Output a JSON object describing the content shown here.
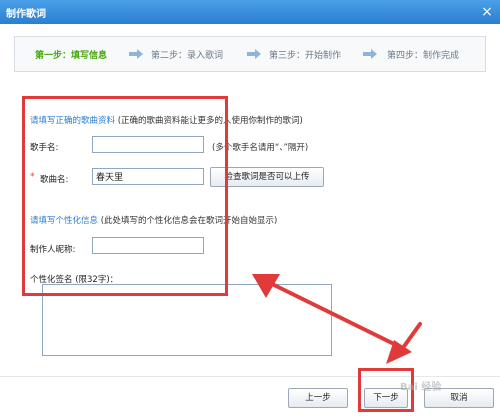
{
  "window": {
    "title": "制作歌词",
    "close_label": "×"
  },
  "steps": [
    {
      "label": "第一步：填写信息"
    },
    {
      "label": "第二步：录入歌词"
    },
    {
      "label": "第三步：开始制作"
    },
    {
      "label": "第四步：制作完成"
    }
  ],
  "section1": {
    "title": "请填写正确的歌曲资料",
    "note": "(正确的歌曲资料能让更多的人使用你制作的歌词)"
  },
  "singer": {
    "label": "歌手名:",
    "value": "",
    "hint": "(多个歌手名请用“、”隔开)"
  },
  "song": {
    "star": "*",
    "label": "歌曲名:",
    "value": "春天里",
    "check_button": "检查歌词是否可以上传"
  },
  "section2": {
    "title": "请填写个性化信息",
    "note": "(此处填写的个性化信息会在歌词开始自始显示)"
  },
  "maker": {
    "label": "制作人昵称:",
    "value": ""
  },
  "signature": {
    "label": "个性化签名 (限32字)：",
    "value": ""
  },
  "buttons": {
    "prev": "上一步",
    "next": "下一步",
    "cancel": "取消"
  },
  "watermark": "Bai 经验",
  "colors": {
    "titlebar": "#2b7fd0",
    "active_step": "#48a70c",
    "annotation": "#e03a3a"
  }
}
